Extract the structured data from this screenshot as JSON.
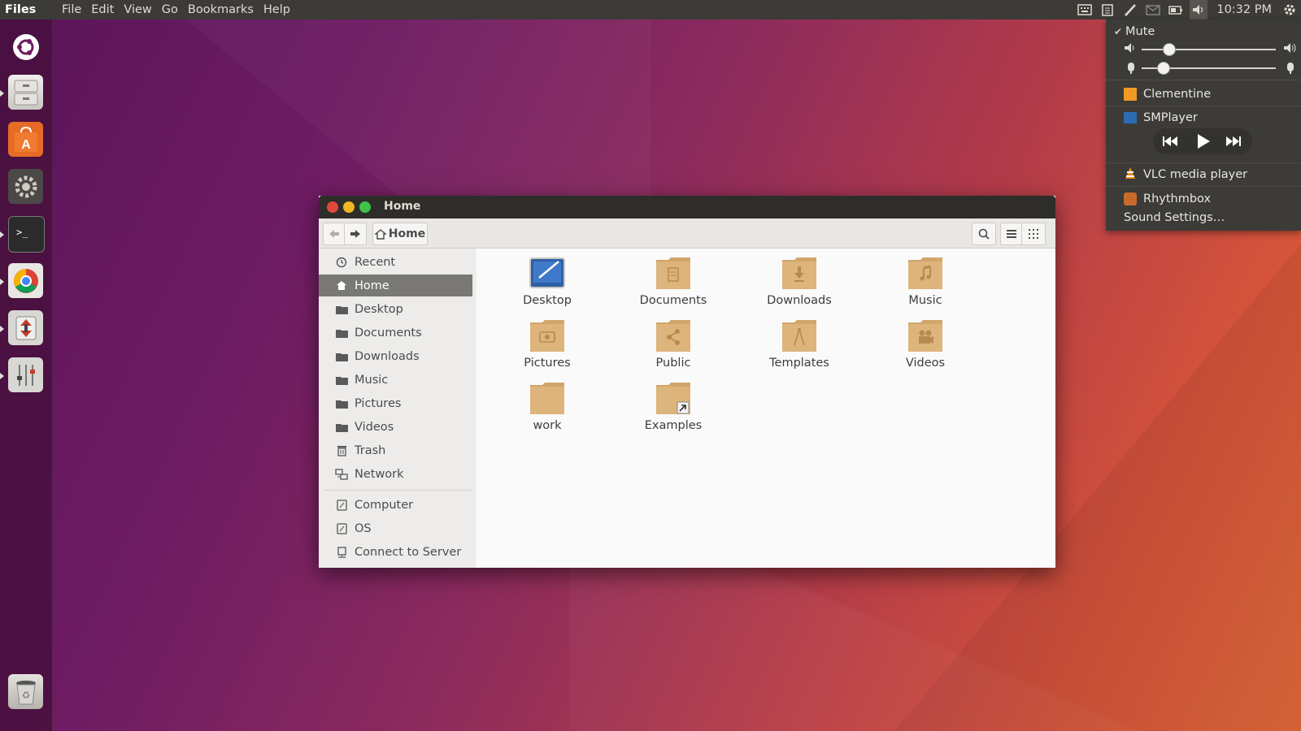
{
  "top_panel": {
    "app_title": "Files",
    "menus": [
      "File",
      "Edit",
      "View",
      "Go",
      "Bookmarks",
      "Help"
    ],
    "clock": "10:32 PM"
  },
  "sound_menu": {
    "mute_label": "Mute",
    "mute_checked": true,
    "output_volume": 0.2,
    "input_volume": 0.16,
    "players": [
      "Clementine",
      "SMPlayer",
      "VLC media player",
      "Rhythmbox"
    ],
    "settings_label": "Sound Settings…"
  },
  "window": {
    "title": "Home",
    "location": "Home",
    "sidebar": {
      "places": [
        "Recent",
        "Home",
        "Desktop",
        "Documents",
        "Downloads",
        "Music",
        "Pictures",
        "Videos",
        "Trash",
        "Network"
      ],
      "devices": [
        "Computer",
        "OS",
        "Connect to Server"
      ],
      "selected": "Home"
    },
    "files": [
      "Desktop",
      "Documents",
      "Downloads",
      "Music",
      "Pictures",
      "Public",
      "Templates",
      "Videos",
      "work",
      "Examples"
    ]
  },
  "colors": {
    "accent_orange": "#e95420",
    "folder_tan": "#d9b27a",
    "close": "#e0483c",
    "minimize": "#f1b721",
    "maximize": "#3ec24a"
  }
}
